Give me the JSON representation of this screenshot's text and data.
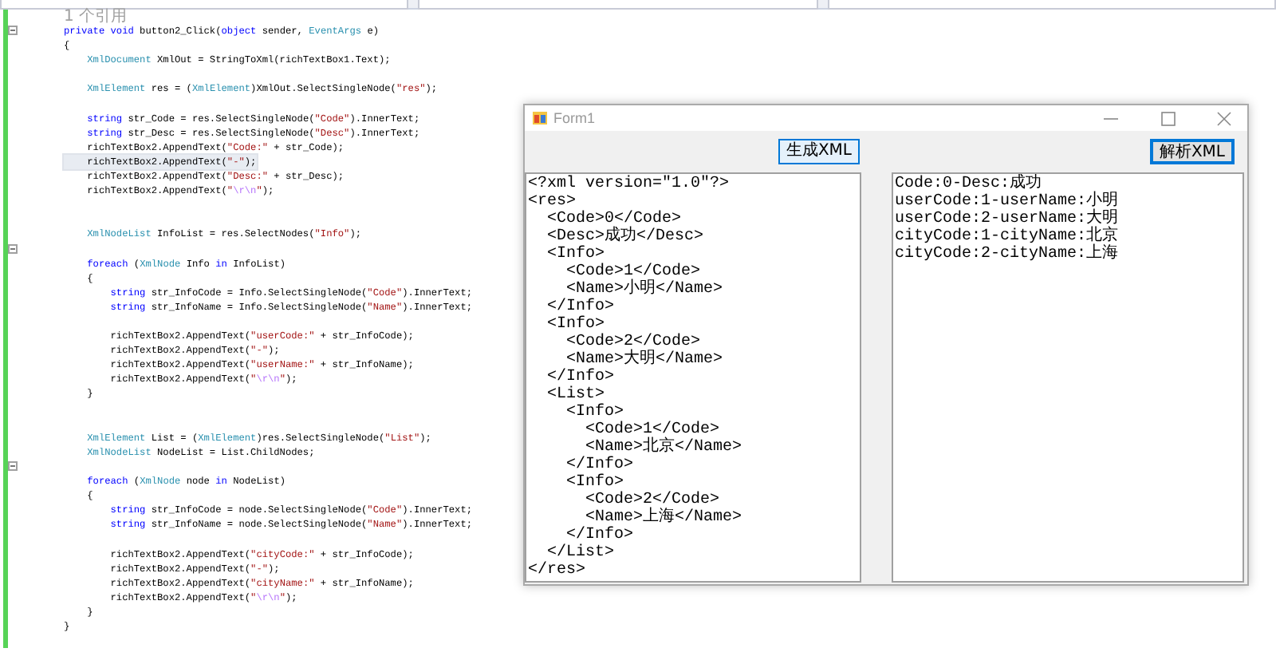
{
  "editor": {
    "codelens": "1 个引用",
    "lines": [
      {
        "expanded": true,
        "tokens": [
          {
            "kind": "kw",
            "text": "private void"
          },
          {
            "kind": "text",
            "text": " button2_Click("
          },
          {
            "kind": "kw",
            "text": "object"
          },
          {
            "kind": "text",
            "text": " sender, "
          },
          {
            "kind": "type",
            "text": "EventArgs"
          },
          {
            "kind": "text",
            "text": " e)"
          }
        ]
      },
      {
        "tokens": [
          {
            "kind": "text",
            "text": "{"
          }
        ]
      },
      {
        "tokens": [
          {
            "kind": "type",
            "text": "    XmlDocument"
          },
          {
            "kind": "text",
            "text": " XmlOut = StringToXml(richTextBox1.Text);"
          }
        ]
      },
      {
        "gap_before": true,
        "tokens": [
          {
            "kind": "type",
            "text": "    XmlElement"
          },
          {
            "kind": "text",
            "text": " res = ("
          },
          {
            "kind": "type",
            "text": "XmlElement"
          },
          {
            "kind": "text",
            "text": ")XmlOut.SelectSingleNode("
          },
          {
            "kind": "str",
            "text": "\"res\""
          },
          {
            "kind": "text",
            "text": ");"
          }
        ]
      },
      {
        "gap_before": true,
        "tokens": [
          {
            "kind": "kw",
            "text": "    string"
          },
          {
            "kind": "text",
            "text": " str_Code = res.SelectSingleNode("
          },
          {
            "kind": "str",
            "text": "\"Code\""
          },
          {
            "kind": "text",
            "text": ").InnerText;"
          }
        ]
      },
      {
        "tokens": [
          {
            "kind": "kw",
            "text": "    string"
          },
          {
            "kind": "text",
            "text": " str_Desc = res.SelectSingleNode("
          },
          {
            "kind": "str",
            "text": "\"Desc\""
          },
          {
            "kind": "text",
            "text": ").InnerText;"
          }
        ]
      },
      {
        "tokens": [
          {
            "kind": "text",
            "text": "    richTextBox2.AppendText("
          },
          {
            "kind": "str",
            "text": "\"Code:\""
          },
          {
            "kind": "text",
            "text": " + str_Code);"
          }
        ]
      },
      {
        "highlighted": true,
        "tokens": [
          {
            "kind": "text",
            "text": "    richTextBox2.AppendText("
          },
          {
            "kind": "str",
            "text": "\"-\""
          },
          {
            "kind": "text",
            "text": ");"
          }
        ]
      },
      {
        "tokens": [
          {
            "kind": "text",
            "text": "    richTextBox2.AppendText("
          },
          {
            "kind": "str",
            "text": "\"Desc:\""
          },
          {
            "kind": "text",
            "text": " + str_Desc);"
          }
        ]
      },
      {
        "tokens": [
          {
            "kind": "text",
            "text": "    richTextBox2.AppendText("
          },
          {
            "kind": "str",
            "text": "\""
          },
          {
            "kind": "esc",
            "text": "\\r\\n"
          },
          {
            "kind": "str",
            "text": "\""
          },
          {
            "kind": "text",
            "text": ");"
          }
        ]
      },
      {
        "gap_before": true,
        "double_gap": true,
        "tokens": [
          {
            "kind": "type",
            "text": "    XmlNodeList"
          },
          {
            "kind": "text",
            "text": " InfoList = res.SelectNodes("
          },
          {
            "kind": "str",
            "text": "\"Info\""
          },
          {
            "kind": "text",
            "text": ");"
          }
        ]
      },
      {
        "gap_before": true,
        "expanded": true,
        "tokens": [
          {
            "kind": "kw",
            "text": "    foreach"
          },
          {
            "kind": "text",
            "text": " ("
          },
          {
            "kind": "type",
            "text": "XmlNode"
          },
          {
            "kind": "text",
            "text": " Info "
          },
          {
            "kind": "kw",
            "text": "in"
          },
          {
            "kind": "text",
            "text": " InfoList)"
          }
        ]
      },
      {
        "tokens": [
          {
            "kind": "text",
            "text": "    {"
          }
        ]
      },
      {
        "tokens": [
          {
            "kind": "kw",
            "text": "        string"
          },
          {
            "kind": "text",
            "text": " str_InfoCode = Info.SelectSingleNode("
          },
          {
            "kind": "str",
            "text": "\"Code\""
          },
          {
            "kind": "text",
            "text": ").InnerText;"
          }
        ]
      },
      {
        "tokens": [
          {
            "kind": "kw",
            "text": "        string"
          },
          {
            "kind": "text",
            "text": " str_InfoName = Info.SelectSingleNode("
          },
          {
            "kind": "str",
            "text": "\"Name\""
          },
          {
            "kind": "text",
            "text": ").InnerText;"
          }
        ]
      },
      {
        "gap_before": true,
        "tokens": [
          {
            "kind": "text",
            "text": "        richTextBox2.AppendText("
          },
          {
            "kind": "str",
            "text": "\"userCode:\""
          },
          {
            "kind": "text",
            "text": " + str_InfoCode);"
          }
        ]
      },
      {
        "tokens": [
          {
            "kind": "text",
            "text": "        richTextBox2.AppendText("
          },
          {
            "kind": "str",
            "text": "\"-\""
          },
          {
            "kind": "text",
            "text": ");"
          }
        ]
      },
      {
        "tokens": [
          {
            "kind": "text",
            "text": "        richTextBox2.AppendText("
          },
          {
            "kind": "str",
            "text": "\"userName:\""
          },
          {
            "kind": "text",
            "text": " + str_InfoName);"
          }
        ]
      },
      {
        "tokens": [
          {
            "kind": "text",
            "text": "        richTextBox2.AppendText("
          },
          {
            "kind": "str",
            "text": "\""
          },
          {
            "kind": "esc",
            "text": "\\r\\n"
          },
          {
            "kind": "str",
            "text": "\""
          },
          {
            "kind": "text",
            "text": ");"
          }
        ]
      },
      {
        "tokens": [
          {
            "kind": "text",
            "text": "    }"
          }
        ]
      },
      {
        "gap_before": true,
        "double_gap": true,
        "tokens": [
          {
            "kind": "type",
            "text": "    XmlElement"
          },
          {
            "kind": "text",
            "text": " List = ("
          },
          {
            "kind": "type",
            "text": "XmlElement"
          },
          {
            "kind": "text",
            "text": ")res.SelectSingleNode("
          },
          {
            "kind": "str",
            "text": "\"List\""
          },
          {
            "kind": "text",
            "text": ");"
          }
        ]
      },
      {
        "tokens": [
          {
            "kind": "type",
            "text": "    XmlNodeList"
          },
          {
            "kind": "text",
            "text": " NodeList = List.ChildNodes;"
          }
        ]
      },
      {
        "gap_before": true,
        "expanded": true,
        "tokens": [
          {
            "kind": "kw",
            "text": "    foreach"
          },
          {
            "kind": "text",
            "text": " ("
          },
          {
            "kind": "type",
            "text": "XmlNode"
          },
          {
            "kind": "text",
            "text": " node "
          },
          {
            "kind": "kw",
            "text": "in"
          },
          {
            "kind": "text",
            "text": " NodeList)"
          }
        ]
      },
      {
        "tokens": [
          {
            "kind": "text",
            "text": "    {"
          }
        ]
      },
      {
        "tokens": [
          {
            "kind": "kw",
            "text": "        string"
          },
          {
            "kind": "text",
            "text": " str_InfoCode = node.SelectSingleNode("
          },
          {
            "kind": "str",
            "text": "\"Code\""
          },
          {
            "kind": "text",
            "text": ").InnerText;"
          }
        ]
      },
      {
        "tokens": [
          {
            "kind": "kw",
            "text": "        string"
          },
          {
            "kind": "text",
            "text": " str_InfoName = node.SelectSingleNode("
          },
          {
            "kind": "str",
            "text": "\"Name\""
          },
          {
            "kind": "text",
            "text": ").InnerText;"
          }
        ]
      },
      {
        "gap_before": true,
        "tokens": [
          {
            "kind": "text",
            "text": "        richTextBox2.AppendText("
          },
          {
            "kind": "str",
            "text": "\"cityCode:\""
          },
          {
            "kind": "text",
            "text": " + str_InfoCode);"
          }
        ]
      },
      {
        "tokens": [
          {
            "kind": "text",
            "text": "        richTextBox2.AppendText("
          },
          {
            "kind": "str",
            "text": "\"-\""
          },
          {
            "kind": "text",
            "text": ");"
          }
        ]
      },
      {
        "tokens": [
          {
            "kind": "text",
            "text": "        richTextBox2.AppendText("
          },
          {
            "kind": "str",
            "text": "\"cityName:\""
          },
          {
            "kind": "text",
            "text": " + str_InfoName);"
          }
        ]
      },
      {
        "tokens": [
          {
            "kind": "text",
            "text": "        richTextBox2.AppendText("
          },
          {
            "kind": "str",
            "text": "\""
          },
          {
            "kind": "esc",
            "text": "\\r\\n"
          },
          {
            "kind": "str",
            "text": "\""
          },
          {
            "kind": "text",
            "text": ");"
          }
        ]
      },
      {
        "tokens": [
          {
            "kind": "text",
            "text": "    }"
          }
        ]
      },
      {
        "tokens": [
          {
            "kind": "text",
            "text": "}"
          }
        ]
      }
    ]
  },
  "form_window": {
    "title": "Form1",
    "buttons": [
      {
        "label": "生成XML",
        "hovered": true,
        "default": false
      },
      {
        "label": "解析XML",
        "hovered": false,
        "default": true
      }
    ],
    "text_boxes": [
      {
        "lines": [
          "<?xml version=\"1.0\"?>",
          "<res>",
          "  <Code>0</Code>",
          "  <Desc>成功</Desc>",
          "  <Info>",
          "    <Code>1</Code>",
          "    <Name>小明</Name>",
          "  </Info>",
          "  <Info>",
          "    <Code>2</Code>",
          "    <Name>大明</Name>",
          "  </Info>",
          "  <List>",
          "    <Info>",
          "      <Code>1</Code>",
          "      <Name>北京</Name>",
          "    </Info>",
          "    <Info>",
          "      <Code>2</Code>",
          "      <Name>上海</Name>",
          "    </Info>",
          "  </List>",
          "</res>"
        ]
      },
      {
        "lines": [
          "Code:0-Desc:成功",
          "userCode:1-userName:小明",
          "userCode:2-userName:大明",
          "cityCode:1-cityName:北京",
          "cityCode:2-cityName:上海"
        ]
      }
    ]
  }
}
